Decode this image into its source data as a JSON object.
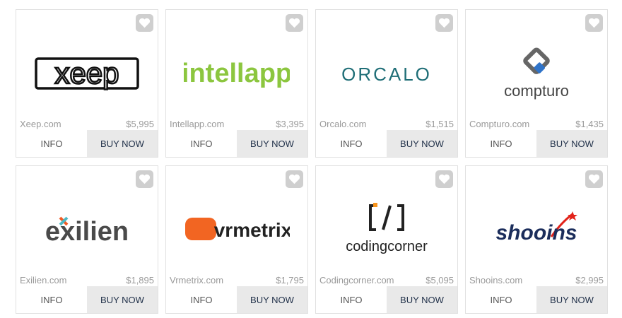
{
  "cards": [
    {
      "name": "Xeep.com",
      "price": "$5,995",
      "logo_text": "xeep",
      "info": "INFO",
      "buy": "BUY NOW"
    },
    {
      "name": "Intellapp.com",
      "price": "$3,395",
      "logo_text": "intellapp",
      "info": "INFO",
      "buy": "BUY NOW"
    },
    {
      "name": "Orcalo.com",
      "price": "$1,515",
      "logo_text": "ORCALO",
      "info": "INFO",
      "buy": "BUY NOW"
    },
    {
      "name": "Compturo.com",
      "price": "$1,435",
      "logo_text": "compturo",
      "info": "INFO",
      "buy": "BUY NOW"
    },
    {
      "name": "Exilien.com",
      "price": "$1,895",
      "logo_text": "exilien",
      "info": "INFO",
      "buy": "BUY NOW"
    },
    {
      "name": "Vrmetrix.com",
      "price": "$1,795",
      "logo_text": "vrmetrix",
      "info": "INFO",
      "buy": "BUY NOW"
    },
    {
      "name": "Codingcorner.com",
      "price": "$5,095",
      "logo_text": "codingcorner",
      "info": "INFO",
      "buy": "BUY NOW"
    },
    {
      "name": "Shooins.com",
      "price": "$2,995",
      "logo_text": "shooins",
      "info": "INFO",
      "buy": "BUY NOW"
    }
  ],
  "icons": {
    "favorite": "heart-icon"
  },
  "colors": {
    "buy_bg": "#e9e9e9",
    "buy_text": "#1f2f48",
    "fav_bg": "#cfcfcf",
    "intellapp_green": "#8cc63f",
    "orcalo_teal": "#1f6e77",
    "compturo_blue": "#2f73c8",
    "exilien_orange": "#f15a24",
    "vrmetrix_orange": "#f26522",
    "codingcorner_orange": "#f7941d",
    "shooins_navy": "#1b2d5b",
    "shooins_red": "#e2231a"
  }
}
